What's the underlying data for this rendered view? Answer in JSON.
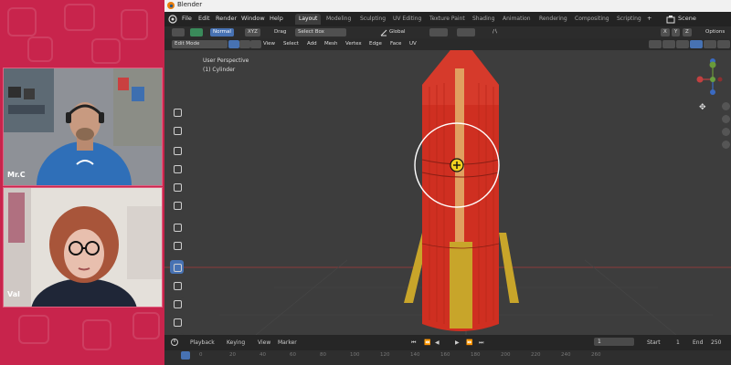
{
  "window": {
    "title": "Blender"
  },
  "menu": {
    "items": [
      "File",
      "Edit",
      "Render",
      "Window",
      "Help"
    ],
    "workspaces": [
      "Layout",
      "Modeling",
      "Sculpting",
      "UV Editing",
      "Texture Paint",
      "Shading",
      "Animation",
      "Rendering",
      "Compositing",
      "Scripting"
    ],
    "add_tab": "+",
    "scene_label": "Scene"
  },
  "header1": {
    "mode_normal": "Normal",
    "xyz": "XYZ",
    "drag_label": "Drag",
    "drag_value": "Select Box",
    "orientation": "Global",
    "axes": [
      "X",
      "Y",
      "Z"
    ],
    "options": "Options"
  },
  "header2": {
    "mode": "Edit Mode",
    "menus": [
      "View",
      "Select",
      "Add",
      "Mesh",
      "Vertex",
      "Edge",
      "Face",
      "UV"
    ]
  },
  "viewport": {
    "perspective": "User Perspective",
    "object": "(1) Cylinder"
  },
  "participants": [
    {
      "name": "Mr.C"
    },
    {
      "name": "Val"
    }
  ],
  "timeline": {
    "playback": "Playback",
    "keying": "Keying",
    "view": "View",
    "marker": "Marker",
    "current_frame": "1",
    "start_label": "Start",
    "start_value": "1",
    "end_label": "End",
    "end_value": "250",
    "ticks": [
      "0",
      "20",
      "40",
      "60",
      "80",
      "100",
      "120",
      "140",
      "160",
      "180",
      "200",
      "220",
      "240",
      "260"
    ]
  },
  "colors": {
    "rocket_body": "#cf2f21",
    "rocket_fin": "#d6b22a",
    "accent_blue": "#4772b3",
    "brand_red": "#c4234a"
  }
}
